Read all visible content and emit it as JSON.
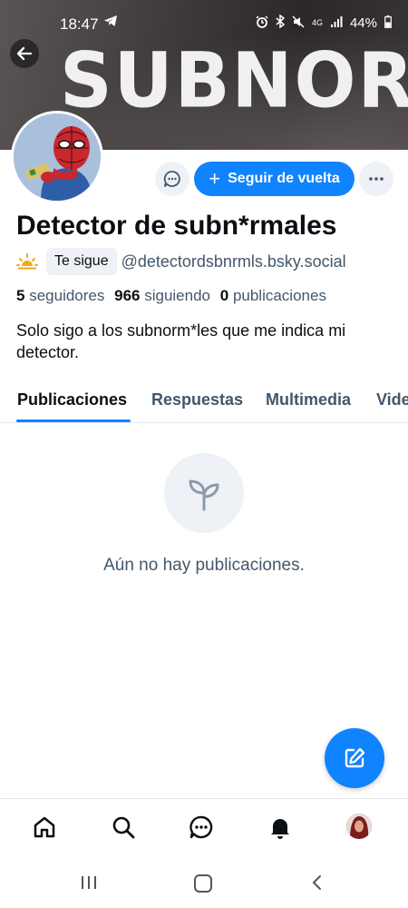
{
  "status_bar": {
    "time": "18:47",
    "battery": "44%",
    "network": "4G"
  },
  "banner": {
    "text": "SUBNORMAL"
  },
  "profile": {
    "display_name": "Detector de subn*rmales",
    "follows_you_label": "Te sigue",
    "handle": "@detectordsbnrmls.bsky.social",
    "bio": "Solo sigo a los subnorm*les que me indica mi detector."
  },
  "actions": {
    "follow_back_label": "Seguir de vuelta"
  },
  "stats": {
    "followers_count": "5",
    "followers_label": "seguidores",
    "following_count": "966",
    "following_label": "siguiendo",
    "posts_count": "0",
    "posts_label": "publicaciones"
  },
  "tabs": [
    {
      "label": "Publicaciones",
      "active": true
    },
    {
      "label": "Respuestas",
      "active": false
    },
    {
      "label": "Multimedia",
      "active": false
    },
    {
      "label": "Vide",
      "active": false
    }
  ],
  "empty_state": {
    "message": "Aún no hay publicaciones.",
    "icon": "seedling-icon"
  },
  "bottom_nav": [
    "home-icon",
    "search-icon",
    "chat-icon",
    "bell-icon",
    "profile-avatar"
  ],
  "colors": {
    "accent": "#1083fe",
    "muted_text": "#42576c",
    "chip_bg": "#eef1f5"
  }
}
